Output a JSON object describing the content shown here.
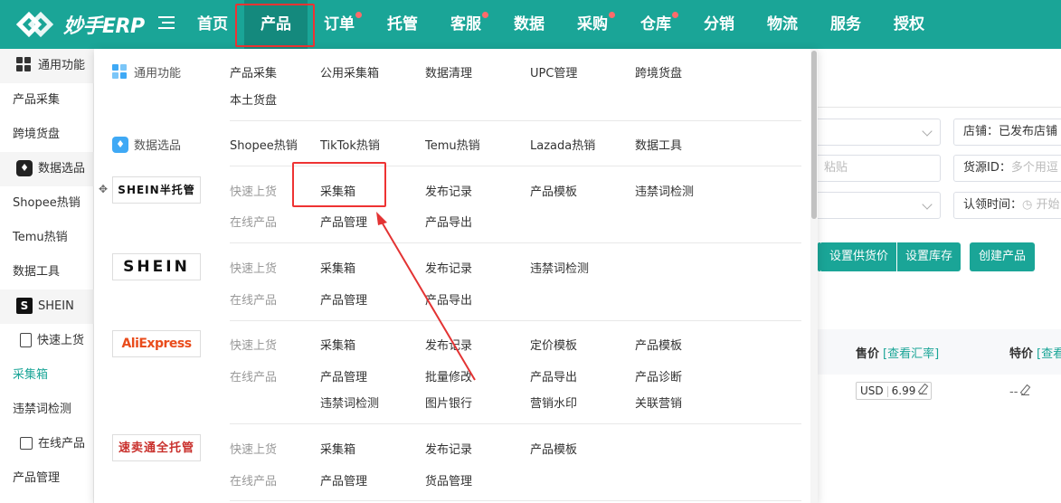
{
  "app": {
    "logo_text": "妙手ERP"
  },
  "nav": {
    "items": [
      {
        "label": "首页"
      },
      {
        "label": "产品"
      },
      {
        "label": "订单"
      },
      {
        "label": "托管"
      },
      {
        "label": "客服"
      },
      {
        "label": "数据"
      },
      {
        "label": "采购"
      },
      {
        "label": "仓库"
      },
      {
        "label": "分销"
      },
      {
        "label": "物流"
      },
      {
        "label": "服务"
      },
      {
        "label": "授权"
      }
    ],
    "active": "产品",
    "badged": [
      "订单",
      "客服",
      "采购",
      "仓库"
    ]
  },
  "sidebar": {
    "items": [
      {
        "label": "通用功能"
      },
      {
        "label": "产品采集"
      },
      {
        "label": "跨境货盘"
      },
      {
        "label": "数据选品"
      },
      {
        "label": "Shopee热销"
      },
      {
        "label": "Temu热销"
      },
      {
        "label": "数据工具"
      },
      {
        "label": "SHEIN"
      },
      {
        "label": "快速上货"
      },
      {
        "label": "采集箱"
      },
      {
        "label": "违禁词检测"
      },
      {
        "label": "在线产品"
      },
      {
        "label": "产品管理"
      }
    ]
  },
  "main": {
    "store_label": "店铺：已发布店铺",
    "paste_placeholder": "粘贴",
    "source_label": "货源ID：",
    "source_placeholder": "多个用逗",
    "claim_label": "认领时间：",
    "claim_placeholder": "开始",
    "buttons": {
      "supply_price": "设置供货价",
      "stock": "设置库存",
      "create": "创建产品"
    },
    "table": {
      "price_header": "售价",
      "price_link": "[查看汇率]",
      "special_header": "特价",
      "special_link": "[查看"
    },
    "row": {
      "currency": "USD",
      "price": "6.99",
      "special": "--"
    }
  },
  "dropdown": {
    "general": {
      "label": "通用功能",
      "links": [
        "产品采集",
        "公用采集箱",
        "数据清理",
        "UPC管理",
        "跨境货盘",
        "本土货盘"
      ]
    },
    "data_select": {
      "label": "数据选品",
      "links": [
        "Shopee热销",
        "TikTok热销",
        "Temu热销",
        "Lazada热销",
        "数据工具"
      ]
    },
    "shein_half": {
      "brand": "SHEIN半托管",
      "quick_label": "快速上货",
      "quick_links": [
        "采集箱",
        "发布记录",
        "产品模板",
        "违禁词检测"
      ],
      "online_label": "在线产品",
      "online_links": [
        "产品管理",
        "产品导出"
      ]
    },
    "shein": {
      "brand": "SHEIN",
      "quick_label": "快速上货",
      "quick_links": [
        "采集箱",
        "发布记录",
        "违禁词检测"
      ],
      "online_label": "在线产品",
      "online_links": [
        "产品管理",
        "产品导出"
      ]
    },
    "aliexpress": {
      "brand": "AliExpress",
      "quick_label": "快速上货",
      "quick_links": [
        "采集箱",
        "发布记录",
        "定价模板",
        "产品模板"
      ],
      "online_label": "在线产品",
      "online_links": [
        "产品管理",
        "批量修改",
        "产品导出",
        "产品诊断",
        "违禁词检测",
        "图片银行",
        "营销水印",
        "关联营销"
      ]
    },
    "sumaitong": {
      "brand": "速卖通全托管",
      "quick_label": "快速上货",
      "quick_links": [
        "采集箱",
        "发布记录",
        "产品模板"
      ],
      "online_label": "在线产品",
      "online_links": [
        "产品管理",
        "货品管理"
      ]
    }
  },
  "colors": {
    "brand": "#1aa597",
    "brand_dark": "#14897d",
    "badge": "#ff6b6b",
    "annotation": "#e33333",
    "aliexpress": "#e94c1c"
  }
}
